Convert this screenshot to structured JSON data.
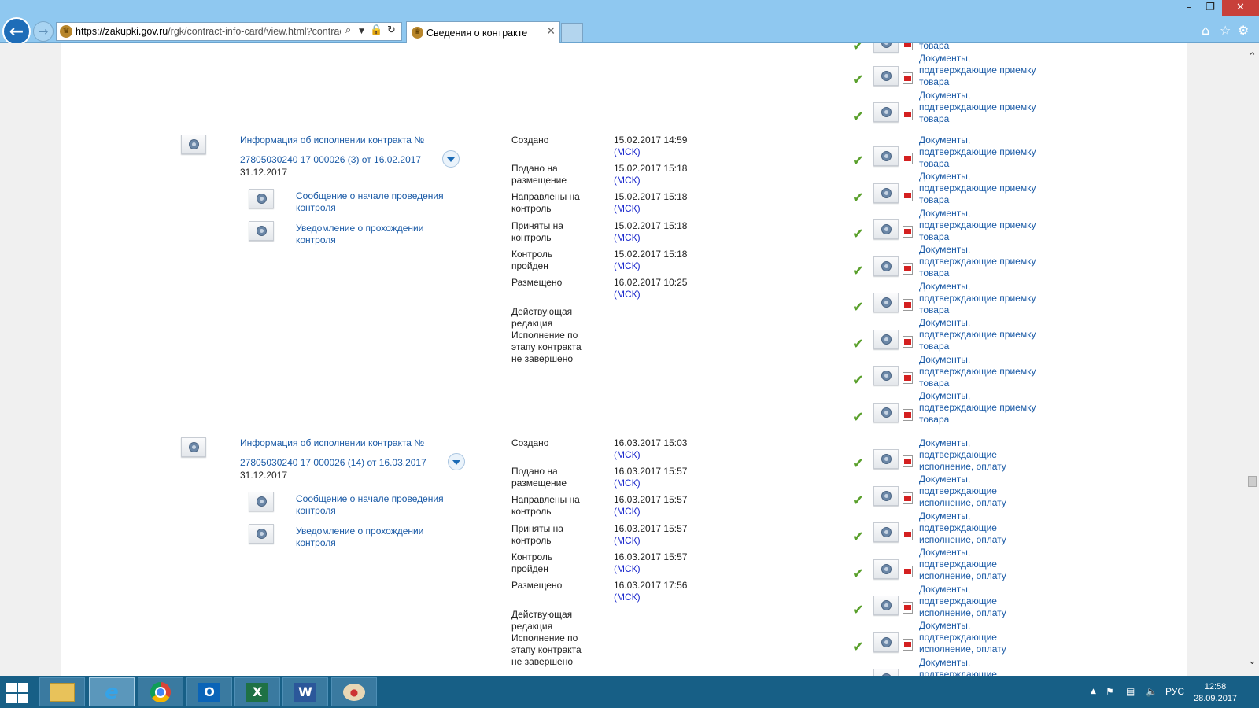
{
  "browser": {
    "url_host": "https://zakupki.gov.ru",
    "url_rest": "/rgk/contract-info-card/view.html?contrac",
    "tab_title": "Сведения о контракте",
    "close_glyph": "✕"
  },
  "top_docs": [
    {
      "l1": "товара",
      "l2": "",
      "l3": ""
    },
    {
      "l1": "Документы,",
      "l2": "подтверждающие приемку",
      "l3": "товара"
    },
    {
      "l1": "Документы,",
      "l2": "подтверждающие приемку",
      "l3": "товара"
    }
  ],
  "blocks": [
    {
      "title": "Информация об исполнении контракта №",
      "number_line": "27805030240 17 000026 (3) от 16.02.2017",
      "date": "31.12.2017",
      "sub_items": [
        {
          "l1": "Сообщение о начале проведения",
          "l2": "контроля"
        },
        {
          "l1": "Уведомление о прохождении",
          "l2": "контроля"
        }
      ],
      "statuses": [
        {
          "l1": "Создано",
          "l2": "",
          "date": "15.02.2017 14:59",
          "tz": "(МСК)"
        },
        {
          "l1": "Подано на",
          "l2": "размещение",
          "date": "15.02.2017 15:18",
          "tz": "(МСК)"
        },
        {
          "l1": "Направлены на",
          "l2": "контроль",
          "date": "15.02.2017 15:18",
          "tz": "(МСК)"
        },
        {
          "l1": "Приняты на",
          "l2": "контроль",
          "date": "15.02.2017 15:18",
          "tz": "(МСК)"
        },
        {
          "l1": "Контроль",
          "l2": "пройден",
          "date": "15.02.2017 15:18",
          "tz": "(МСК)"
        },
        {
          "l1": "Размещено",
          "l2": "",
          "date": "16.02.2017 10:25",
          "tz": "(МСК)"
        }
      ],
      "edition": [
        "Действующая",
        "редакция",
        "Исполнение по",
        "этапу контракта",
        "не завершено"
      ],
      "docs": [
        {
          "l1": "Документы,",
          "l2": "подтверждающие приемку",
          "l3": "товара"
        },
        {
          "l1": "Документы,",
          "l2": "подтверждающие приемку",
          "l3": "товара"
        },
        {
          "l1": "Документы,",
          "l2": "подтверждающие приемку",
          "l3": "товара"
        },
        {
          "l1": "Документы,",
          "l2": "подтверждающие приемку",
          "l3": "товара"
        },
        {
          "l1": "Документы,",
          "l2": "подтверждающие приемку",
          "l3": "товара"
        },
        {
          "l1": "Документы,",
          "l2": "подтверждающие приемку",
          "l3": "товара"
        },
        {
          "l1": "Документы,",
          "l2": "подтверждающие приемку",
          "l3": "товара"
        },
        {
          "l1": "Документы,",
          "l2": "подтверждающие приемку",
          "l3": "товара"
        }
      ]
    },
    {
      "title": "Информация об исполнении контракта №",
      "number_line": "27805030240 17 000026 (14) от 16.03.2017",
      "date": "31.12.2017",
      "sub_items": [
        {
          "l1": "Сообщение о начале проведения",
          "l2": "контроля"
        },
        {
          "l1": "Уведомление о прохождении",
          "l2": "контроля"
        }
      ],
      "statuses": [
        {
          "l1": "Создано",
          "l2": "",
          "date": "16.03.2017 15:03",
          "tz": "(МСК)"
        },
        {
          "l1": "Подано на",
          "l2": "размещение",
          "date": "16.03.2017 15:57",
          "tz": "(МСК)"
        },
        {
          "l1": "Направлены на",
          "l2": "контроль",
          "date": "16.03.2017 15:57",
          "tz": "(МСК)"
        },
        {
          "l1": "Приняты на",
          "l2": "контроль",
          "date": "16.03.2017 15:57",
          "tz": "(МСК)"
        },
        {
          "l1": "Контроль",
          "l2": "пройден",
          "date": "16.03.2017 15:57",
          "tz": "(МСК)"
        },
        {
          "l1": "Размещено",
          "l2": "",
          "date": "16.03.2017 17:56",
          "tz": "(МСК)"
        }
      ],
      "edition": [
        "Действующая",
        "редакция",
        "Исполнение по",
        "этапу контракта",
        "не завершено"
      ],
      "docs": [
        {
          "l1": "Документы,",
          "l2": "подтверждающие",
          "l3": "исполнение, оплату"
        },
        {
          "l1": "Документы,",
          "l2": "подтверждающие",
          "l3": "исполнение, оплату"
        },
        {
          "l1": "Документы,",
          "l2": "подтверждающие",
          "l3": "исполнение, оплату"
        },
        {
          "l1": "Документы,",
          "l2": "подтверждающие",
          "l3": "исполнение, оплату"
        },
        {
          "l1": "Документы,",
          "l2": "подтверждающие",
          "l3": "исполнение, оплату"
        },
        {
          "l1": "Документы,",
          "l2": "подтверждающие",
          "l3": "исполнение, оплату"
        },
        {
          "l1": "Документы,",
          "l2": "подтверждающие",
          "l3": ""
        }
      ]
    }
  ],
  "taskbar": {
    "apps": [
      "File Explorer",
      "Internet Explorer",
      "Google Chrome",
      "Outlook",
      "Excel",
      "Word",
      "Paint"
    ],
    "language": "РУС",
    "time": "12:58",
    "date": "28.09.2017"
  },
  "colors": {
    "link": "#1a5aa6",
    "msk": "#1a28cc",
    "check": "#5aa02c",
    "chrome": "#8fc8f0",
    "taskbar": "#175f86"
  }
}
